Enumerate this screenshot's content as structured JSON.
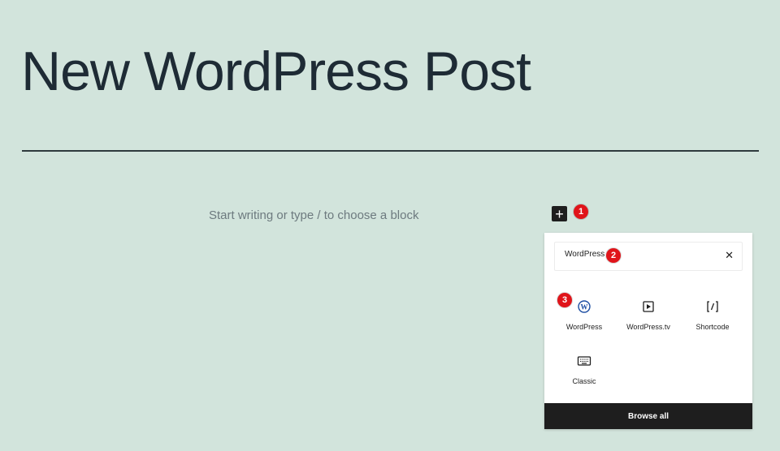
{
  "post": {
    "title": "New WordPress Post",
    "placeholder": "Start writing or type / to choose a block"
  },
  "inserter": {
    "search_value": "WordPress",
    "blocks": [
      {
        "label": "WordPress",
        "icon": "wordpress-logo-icon"
      },
      {
        "label": "WordPress.tv",
        "icon": "video-embed-icon"
      },
      {
        "label": "Shortcode",
        "icon": "shortcode-icon"
      },
      {
        "label": "Classic",
        "icon": "keyboard-icon"
      }
    ],
    "browse_all_label": "Browse all"
  },
  "markers": [
    "1",
    "2",
    "3"
  ],
  "colors": {
    "background": "#d2e4dc",
    "marker": "#e0141a",
    "dark": "#1e1e1e"
  }
}
